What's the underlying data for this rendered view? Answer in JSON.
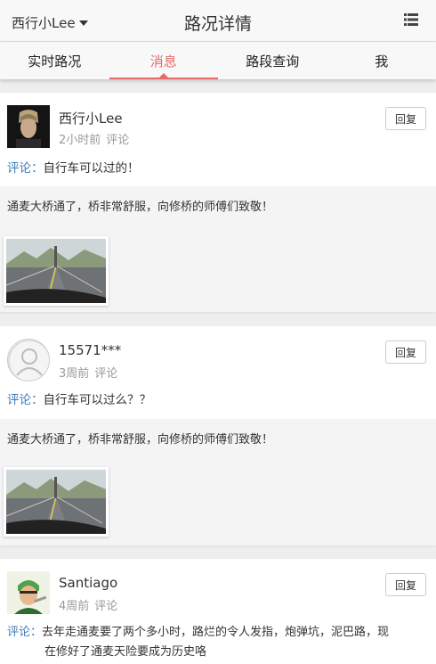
{
  "header": {
    "user_label": "西行小Lee",
    "title": "路况详情",
    "menu_icon": "list-icon"
  },
  "tabs": [
    {
      "label": "实时路况"
    },
    {
      "label": "消息"
    },
    {
      "label": "路段查询"
    },
    {
      "label": "我"
    }
  ],
  "posts": [
    {
      "username": "西行小Lee",
      "time": "2小时前",
      "type": "评论",
      "reply_label": "回复",
      "comment_label": "评论",
      "comment_sep": "：",
      "comment_text": "自行车可以过的！",
      "quote_text": "通麦大桥通了，桥非常舒服，向修桥的师傅们致敬！"
    },
    {
      "username": "15571***",
      "time": "3周前",
      "type": "评论",
      "reply_label": "回复",
      "comment_label": "评论",
      "comment_sep": "：",
      "comment_text": "自行车可以过么？？",
      "quote_text": "通麦大桥通了，桥非常舒服，向修桥的师傅们致敬！"
    },
    {
      "username": "Santiago",
      "time": "4周前",
      "type": "评论",
      "reply_label": "回复",
      "comment_label": "评论",
      "comment_sep": "：",
      "comment_text_line1": "去年走通麦要了两个多小时，路烂的令人发指，炮弹坑，泥巴路，现",
      "comment_text_line2": "在修好了通麦天险要成为历史咯"
    }
  ],
  "colors": {
    "accent": "#e86a6a",
    "link": "#3a7ab8"
  }
}
